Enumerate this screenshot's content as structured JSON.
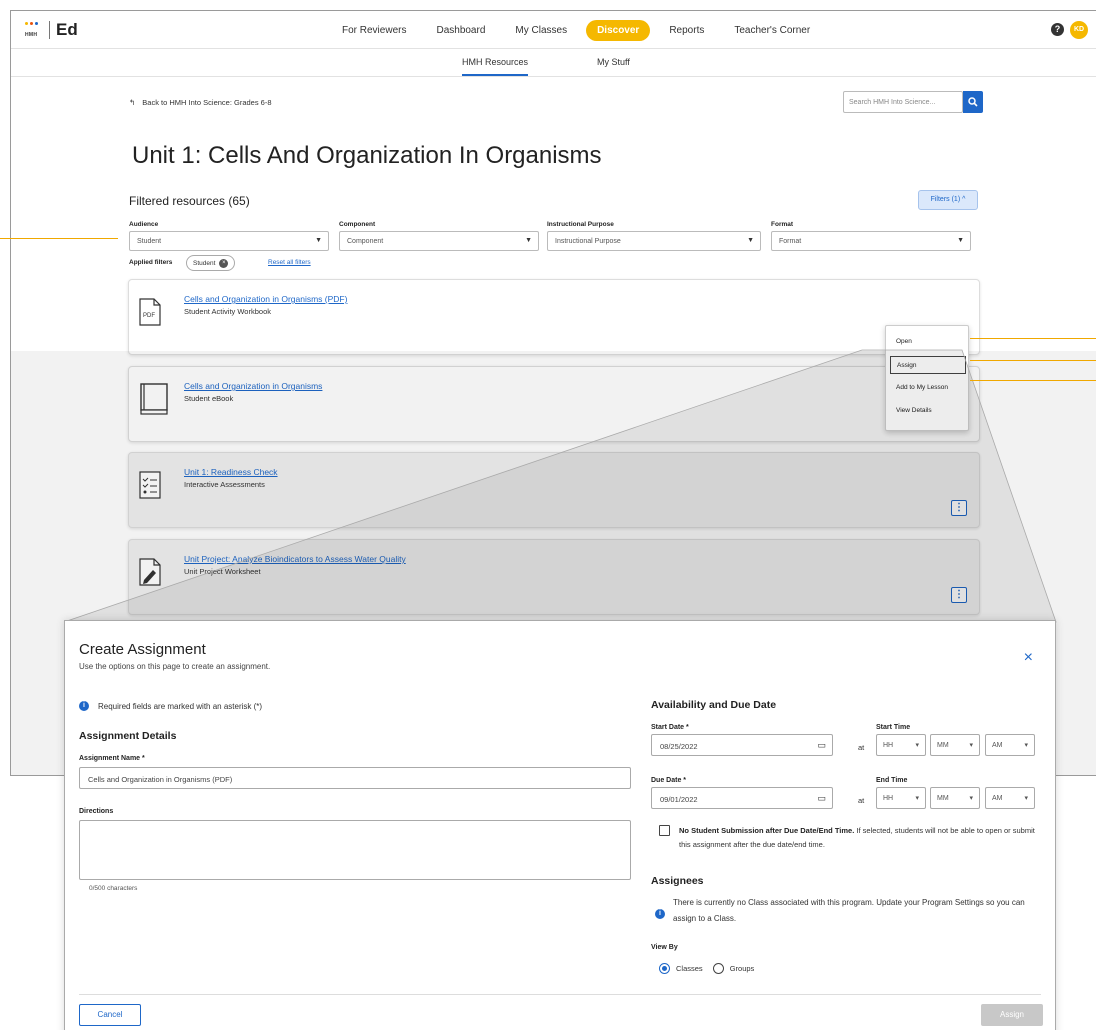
{
  "brand": {
    "name": "Ed",
    "mark_text": "HMH",
    "dot_colors": [
      "#f5b800",
      "#e8540f",
      "#1e67c8"
    ]
  },
  "topnav": {
    "items": [
      {
        "label": "For Reviewers",
        "active": false
      },
      {
        "label": "Dashboard",
        "active": false
      },
      {
        "label": "My Classes",
        "active": false
      },
      {
        "label": "Discover",
        "active": true
      },
      {
        "label": "Reports",
        "active": false
      },
      {
        "label": "Teacher's Corner",
        "active": false
      }
    ],
    "help_glyph": "?",
    "avatar_initials": "KD"
  },
  "subnav": {
    "tabs": [
      {
        "label": "HMH Resources",
        "active": true
      },
      {
        "label": "My Stuff",
        "active": false
      }
    ]
  },
  "back": {
    "arrow": "↰",
    "label": "Back to HMH Into Science: Grades 6-8"
  },
  "search": {
    "placeholder": "Search HMH Into Science...",
    "icon": "search-icon"
  },
  "page_title": "Unit 1: Cells And Organization In Organisms",
  "filtered": {
    "title": "Filtered resources (65)",
    "filters_button": "Filters (1) ^"
  },
  "filters": [
    {
      "label": "Audience",
      "value": "Student"
    },
    {
      "label": "Component",
      "value": "Component"
    },
    {
      "label": "Instructional Purpose",
      "value": "Instructional Purpose"
    },
    {
      "label": "Format",
      "value": "Format"
    }
  ],
  "applied": {
    "label": "Applied filters",
    "chip": "Student",
    "chip_close": "×",
    "reset": "Reset all filters"
  },
  "resources": [
    {
      "title": "Cells and Organization in Organisms (PDF)",
      "subtitle": "Student Activity Workbook",
      "icon": "pdf-icon",
      "icon_text": "PDF"
    },
    {
      "title": "Cells and Organization in Organisms",
      "subtitle": "Student eBook",
      "icon": "book-icon"
    },
    {
      "title": "Unit 1: Readiness Check",
      "subtitle": "Interactive Assessments",
      "icon": "checklist-icon"
    },
    {
      "title": "Unit Project: Analyze Bioindicators to Assess Water Quality",
      "subtitle": "Unit Project Worksheet",
      "icon": "worksheet-icon"
    }
  ],
  "kebab_glyph": "⋮",
  "context_menu": {
    "items": [
      "Open",
      "Assign",
      "Add to My Lesson",
      "View Details"
    ],
    "highlighted": "Assign"
  },
  "callout_color": "#f0a800",
  "modal": {
    "title": "Create Assignment",
    "subtitle": "Use the options on this page to create an assignment.",
    "close_glyph": "×",
    "info_glyph": "i",
    "required_note": "Required fields are marked with an asterisk (*)",
    "details_heading": "Assignment Details",
    "name_label": "Assignment Name *",
    "name_value": "Cells and Organization in Organisms (PDF)",
    "directions_label": "Directions",
    "char_count": "0/500 characters",
    "availability_heading": "Availability and Due Date",
    "start_date_label": "Start Date *",
    "start_date": "08/25/2022",
    "start_time_label": "Start Time",
    "due_date_label": "Due Date *",
    "due_date": "09/01/2022",
    "end_time_label": "End Time",
    "at": "at",
    "time_placeholders": [
      "HH",
      "MM",
      "AM"
    ],
    "calendar_icon": "calendar-icon",
    "no_submission_bold": "No Student Submission after Due Date/End Time.",
    "no_submission_rest": " If selected, students will not be able to open or submit this assignment after the due date/end time.",
    "assignees_heading": "Assignees",
    "assignees_note": "There is currently no Class associated with this program. Update your Program Settings so you can assign to a Class.",
    "view_by_label": "View By",
    "view_by_options": [
      {
        "label": "Classes",
        "selected": true
      },
      {
        "label": "Groups",
        "selected": false
      }
    ],
    "cancel": "Cancel",
    "assign": "Assign"
  },
  "accent_color": "#1e67c8",
  "active_nav_color": "#f5b800"
}
